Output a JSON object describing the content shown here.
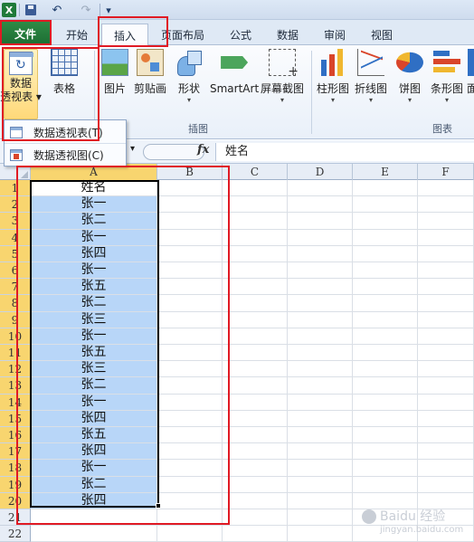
{
  "qat": {
    "undo": "↶",
    "redo": "↷",
    "more": "▾"
  },
  "tabs": [
    "文件",
    "开始",
    "插入",
    "页面布局",
    "公式",
    "数据",
    "审阅",
    "视图"
  ],
  "ribbon": {
    "pivot_label_1": "数据",
    "pivot_label_2": "透视表",
    "pivot_arrow": "▾",
    "table": "表格",
    "picture": "图片",
    "clipart": "剪贴画",
    "shapes": "形状",
    "smartart": "SmartArt",
    "screenshot": "屏幕截图",
    "column_chart": "柱形图",
    "line_chart": "折线图",
    "pie_chart": "饼图",
    "bar_chart": "条形图",
    "area_chart": "面",
    "group_illustrations": "插图",
    "group_charts": "图表"
  },
  "dropdown": {
    "pivot_table": "数据透视表(T)",
    "pivot_chart": "数据透视图(C)"
  },
  "formula_bar": {
    "fx": "fx",
    "value": "姓名"
  },
  "columns": [
    "A",
    "B",
    "C",
    "D",
    "E",
    "F"
  ],
  "rows": [
    {
      "n": "1",
      "a": "姓名"
    },
    {
      "n": "2",
      "a": "张一"
    },
    {
      "n": "3",
      "a": "张二"
    },
    {
      "n": "4",
      "a": "张一"
    },
    {
      "n": "5",
      "a": "张四"
    },
    {
      "n": "6",
      "a": "张一"
    },
    {
      "n": "7",
      "a": "张五"
    },
    {
      "n": "8",
      "a": "张二"
    },
    {
      "n": "9",
      "a": "张三"
    },
    {
      "n": "10",
      "a": "张一"
    },
    {
      "n": "11",
      "a": "张五"
    },
    {
      "n": "12",
      "a": "张三"
    },
    {
      "n": "13",
      "a": "张二"
    },
    {
      "n": "14",
      "a": "张一"
    },
    {
      "n": "15",
      "a": "张四"
    },
    {
      "n": "16",
      "a": "张五"
    },
    {
      "n": "17",
      "a": "张四"
    },
    {
      "n": "18",
      "a": "张一"
    },
    {
      "n": "19",
      "a": "张二"
    },
    {
      "n": "20",
      "a": "张四"
    },
    {
      "n": "21",
      "a": ""
    },
    {
      "n": "22",
      "a": ""
    }
  ],
  "watermark": {
    "main": "Baidu 经验",
    "sub": "jingyan.baidu.com"
  },
  "colors": {
    "selection": "#b8d6f8",
    "annotation": "#e01a24",
    "file_tab": "#1f7a3a"
  }
}
